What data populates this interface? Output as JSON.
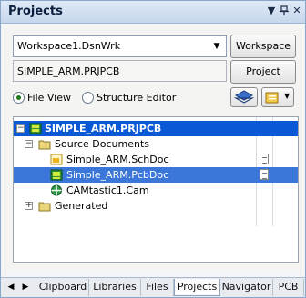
{
  "panel": {
    "title": "Projects",
    "dropdown_icon": "triangle-down-icon",
    "pin_icon": "pin-icon",
    "close_icon": "close-icon"
  },
  "workspace": {
    "selected": "Workspace1.DsnWrk",
    "button_label": "Workspace"
  },
  "project": {
    "value": "SIMPLE_ARM.PRJPCB",
    "button_label": "Project"
  },
  "view_mode": {
    "options": [
      "File View",
      "Structure Editor"
    ],
    "selected": "File View"
  },
  "tree": {
    "root": "SIMPLE_ARM.PRJPCB",
    "folders": [
      {
        "label": "Source Documents",
        "expanded": true,
        "items": [
          {
            "label": "Simple_ARM.SchDoc",
            "icon": "schematic-doc-icon",
            "selected": false
          },
          {
            "label": "Simple_ARM.PcbDoc",
            "icon": "pcb-doc-icon",
            "selected": true
          },
          {
            "label": "CAMtastic1.Cam",
            "icon": "cam-doc-icon",
            "selected": false
          }
        ]
      },
      {
        "label": "Generated",
        "expanded": false,
        "items": []
      }
    ]
  },
  "tabs": [
    "Clipboard",
    "Libraries",
    "Files",
    "Projects",
    "Navigator",
    "PCB"
  ],
  "active_tab": "Projects",
  "colors": {
    "selection": "#0a58d6",
    "title_bar": "#c6d6ec"
  }
}
